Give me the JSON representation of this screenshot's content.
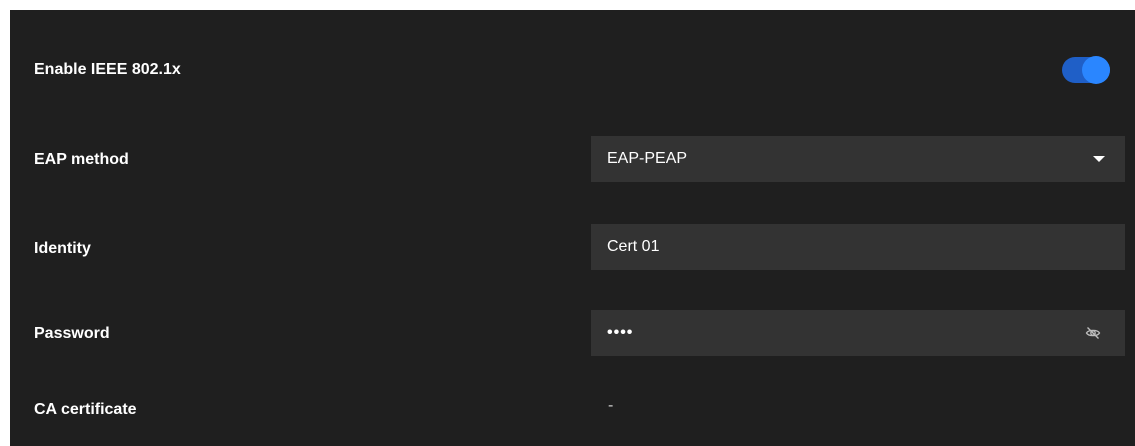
{
  "settings": {
    "enable_8021x": {
      "label": "Enable IEEE 802.1x",
      "enabled": true
    },
    "eap_method": {
      "label": "EAP method",
      "value": "EAP-PEAP",
      "icon": "caret-down-icon"
    },
    "identity": {
      "label": "Identity",
      "value": "Cert 01"
    },
    "password": {
      "label": "Password",
      "value": "••••",
      "icon": "eye-off-icon"
    },
    "ca_certificate": {
      "label": "CA certificate",
      "value": "-"
    }
  },
  "colors": {
    "panel_bg": "#1f1f1f",
    "field_bg": "#333333",
    "toggle_track": "#1f5fc7",
    "toggle_knob": "#2a86ff",
    "text": "#ffffff"
  }
}
